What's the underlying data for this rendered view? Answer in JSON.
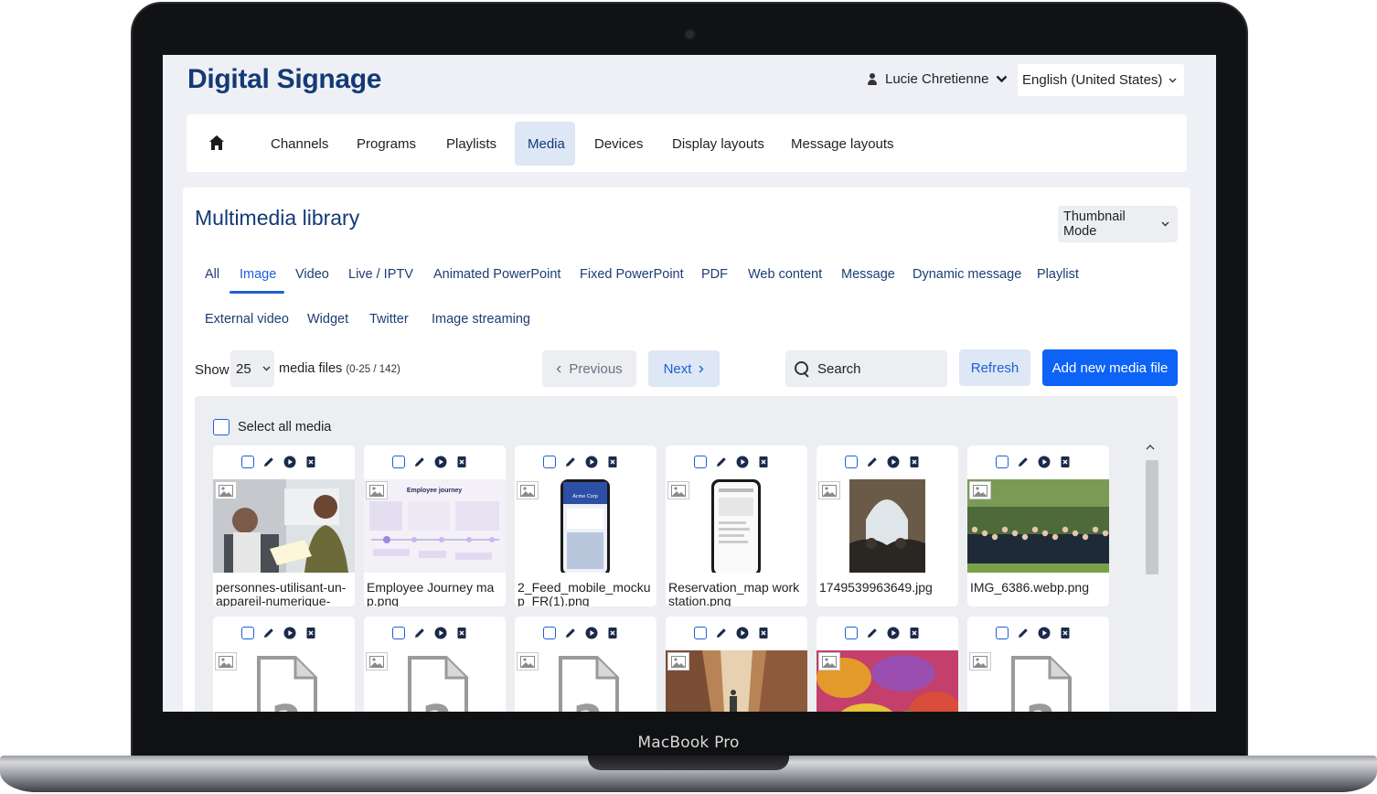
{
  "device": {
    "label": "MacBook Pro"
  },
  "app": {
    "title": "Digital Signage"
  },
  "header": {
    "user_name": "Lucie Chretienne",
    "language": "English (United States)"
  },
  "nav": {
    "items": [
      {
        "label": "Channels"
      },
      {
        "label": "Programs"
      },
      {
        "label": "Playlists"
      },
      {
        "label": "Media",
        "active": true
      },
      {
        "label": "Devices"
      },
      {
        "label": "Display layouts"
      },
      {
        "label": "Message layouts"
      }
    ]
  },
  "library": {
    "title": "Multimedia library",
    "view_mode": "Thumbnail Mode",
    "tabs_row1": [
      {
        "label": "All"
      },
      {
        "label": "Image",
        "active": true
      },
      {
        "label": "Video"
      },
      {
        "label": "Live / IPTV"
      },
      {
        "label": "Animated PowerPoint"
      },
      {
        "label": "Fixed PowerPoint"
      },
      {
        "label": "PDF"
      },
      {
        "label": "Web content"
      },
      {
        "label": "Message"
      },
      {
        "label": "Dynamic message"
      },
      {
        "label": "Playlist"
      }
    ],
    "tabs_row2": [
      {
        "label": "External video"
      },
      {
        "label": "Widget"
      },
      {
        "label": "Twitter"
      },
      {
        "label": "Image streaming"
      }
    ]
  },
  "toolbar": {
    "show_label": "Show",
    "page_size": "25",
    "files_label": "media files",
    "files_range": "(0-25 / 142)",
    "prev_label": "Previous",
    "next_label": "Next",
    "search_placeholder": "Search",
    "refresh_label": "Refresh",
    "add_label": "Add new media file"
  },
  "media": {
    "select_all_label": "Select all media",
    "items": [
      {
        "name": "personnes-utilisant-un-appareil-numerique-",
        "thumb": "office-photo"
      },
      {
        "name": "Employee Journey map.png",
        "thumb": "journey-diagram",
        "thumb_title": "Employee journey"
      },
      {
        "name": "2_Feed_mobile_mockup_FR(1).png",
        "thumb": "phone-mockup",
        "thumb_title": "Acme Corp"
      },
      {
        "name": "Reservation_map workstation.png",
        "thumb": "phone-mockup-light"
      },
      {
        "name": "1749539963649.jpg",
        "thumb": "room-photo"
      },
      {
        "name": "IMG_6386.webp.png",
        "thumb": "group-photo"
      },
      {
        "name": "",
        "thumb": "unknown-file"
      },
      {
        "name": "",
        "thumb": "unknown-file"
      },
      {
        "name": "",
        "thumb": "unknown-file"
      },
      {
        "name": "",
        "thumb": "canyon-photo"
      },
      {
        "name": "",
        "thumb": "leaves-photo"
      },
      {
        "name": "",
        "thumb": "unknown-file"
      }
    ]
  },
  "colors": {
    "brand": "#143a74",
    "accent": "#0d63f5",
    "accent_soft": "#dde7f5"
  }
}
